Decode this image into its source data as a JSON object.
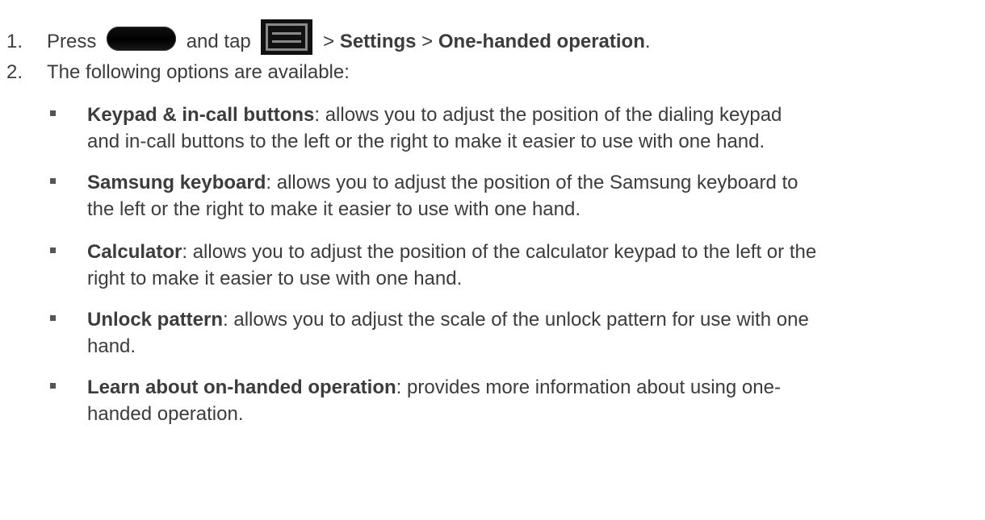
{
  "steps": [
    {
      "number": "1.",
      "press": "Press",
      "and_tap": "and tap",
      "sep1": ">",
      "settings": "Settings",
      "sep2": ">",
      "target": "One-handed operation",
      "end": "."
    },
    {
      "number": "2.",
      "text": "The following options are available:"
    }
  ],
  "icons": {
    "home": "home-key-icon",
    "menu": "menu-key-icon"
  },
  "options": [
    {
      "name": "Keypad & in-call buttons",
      "line1": ": allows you to adjust the position of the dialing keypad",
      "line2": "and in-call buttons to the left or the right to make it easier to use with one hand."
    },
    {
      "name": "Samsung keyboard",
      "line1": ": allows you to adjust the position of the Samsung keyboard to",
      "line2": "the left or the right to make it easier to use with one hand."
    },
    {
      "name": "Calculator",
      "line1": ": allows you to adjust the position of the calculator keypad to the left or the",
      "line2": "right to make it easier to use with one hand."
    },
    {
      "name": "Unlock pattern",
      "line1": ": allows you to adjust the scale of the unlock pattern for use with one",
      "line2": "hand."
    },
    {
      "name": "Learn about on-handed operation",
      "line1": ": provides more information about using one-",
      "line2": "handed operation."
    }
  ]
}
